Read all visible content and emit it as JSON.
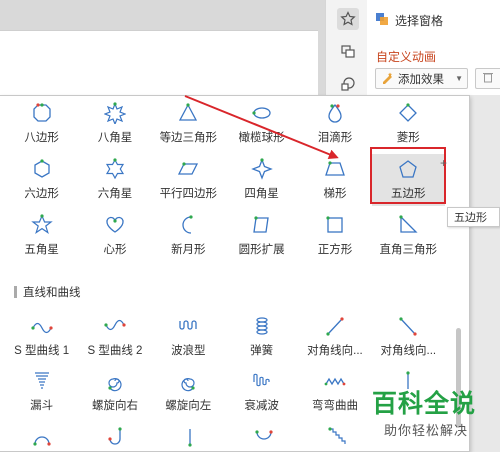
{
  "side_pane": {
    "selection_pane_label": "选择窗格",
    "title": "自定义动画",
    "add_effect_label": "添加效果"
  },
  "shapes": {
    "rows": [
      [
        {
          "label": "八边形",
          "icon": "octagon-icon"
        },
        {
          "label": "八角星",
          "icon": "eight-point-star-icon"
        },
        {
          "label": "等边三角形",
          "icon": "equilateral-triangle-icon"
        },
        {
          "label": "橄榄球形",
          "icon": "football-icon"
        },
        {
          "label": "泪滴形",
          "icon": "teardrop-icon"
        },
        {
          "label": "菱形",
          "icon": "diamond-icon"
        }
      ],
      [
        {
          "label": "六边形",
          "icon": "hexagon-icon"
        },
        {
          "label": "六角星",
          "icon": "six-point-star-icon"
        },
        {
          "label": "平行四边形",
          "icon": "parallelogram-icon"
        },
        {
          "label": "四角星",
          "icon": "four-point-star-icon"
        },
        {
          "label": "梯形",
          "icon": "trapezoid-icon"
        },
        {
          "label": "五边形",
          "icon": "pentagon-icon"
        }
      ],
      [
        {
          "label": "五角星",
          "icon": "five-point-star-icon"
        },
        {
          "label": "心形",
          "icon": "heart-icon"
        },
        {
          "label": "新月形",
          "icon": "crescent-icon"
        },
        {
          "label": "圆形扩展",
          "icon": "circle-expand-icon"
        },
        {
          "label": "正方形",
          "icon": "square-icon"
        },
        {
          "label": "直角三角形",
          "icon": "right-triangle-icon"
        }
      ]
    ],
    "selected": "五边形"
  },
  "lines_section": {
    "title": "直线和曲线",
    "rows": [
      [
        {
          "label": "S 型曲线 1",
          "icon": "s-curve-1-icon"
        },
        {
          "label": "S 型曲线 2",
          "icon": "s-curve-2-icon"
        },
        {
          "label": "波浪型",
          "icon": "wave-icon"
        },
        {
          "label": "弹簧",
          "icon": "spring-icon"
        },
        {
          "label": "对角线向...",
          "icon": "diagonal-down-right-icon"
        },
        {
          "label": "对角线向...",
          "icon": "diagonal-up-right-icon"
        }
      ],
      [
        {
          "label": "漏斗",
          "icon": "funnel-icon"
        },
        {
          "label": "螺旋向右",
          "icon": "spiral-right-icon"
        },
        {
          "label": "螺旋向左",
          "icon": "spiral-left-icon"
        },
        {
          "label": "衰减波",
          "icon": "decaying-wave-icon"
        },
        {
          "label": "弯弯曲曲",
          "icon": "zigzag-icon"
        },
        {
          "label": "",
          "icon": "vertical-line-icon"
        }
      ],
      [
        {
          "label": "",
          "icon": "arc-down-icon"
        },
        {
          "label": "",
          "icon": "j-curve-icon"
        },
        {
          "label": "",
          "icon": "line-down-icon"
        },
        {
          "label": "",
          "icon": "u-curve-icon"
        },
        {
          "label": "",
          "icon": "staircase-icon"
        },
        {
          "label": "",
          "icon": "blank-icon"
        }
      ]
    ]
  },
  "tooltip": "五边形",
  "watermark": {
    "logo": "百科全说",
    "tagline": "助你轻松解决"
  },
  "colors": {
    "accent_red": "#d9262b",
    "title_orange": "#c8461f",
    "icon_blue": "#3a76c4",
    "path_green": "#2fa84f",
    "path_red": "#e0453a",
    "watermark_green": "#24a145"
  }
}
